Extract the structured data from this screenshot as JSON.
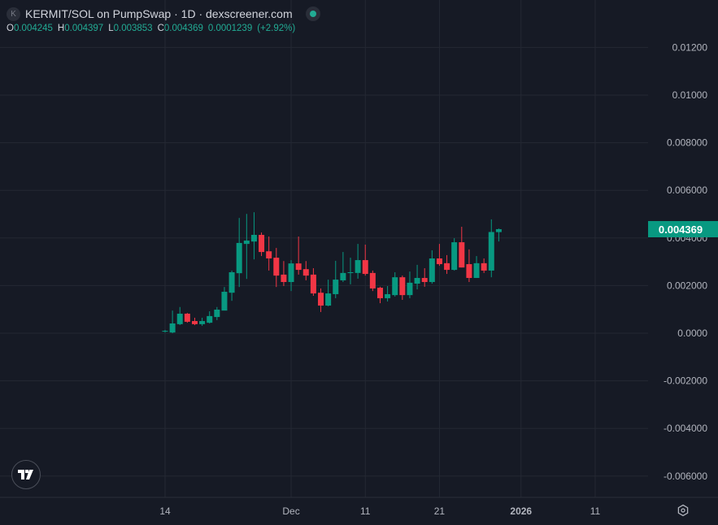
{
  "header": {
    "symbol_logo_letter": "K",
    "title": "KERMIT/SOL on PumpSwap · 1D · dexscreener.com",
    "ohlc": {
      "o_label": "O",
      "o": "0.004245",
      "h_label": "H",
      "h": "0.004397",
      "l_label": "L",
      "l": "0.003853",
      "c_label": "C",
      "c": "0.004369",
      "change": "0.0001239",
      "change_pct": "(+2.92%)"
    }
  },
  "colors": {
    "up": "#089981",
    "down": "#f23645",
    "background": "#161a25",
    "grid": "#242833",
    "last_price": "#089981"
  },
  "chart_data": {
    "type": "candlestick",
    "title": "KERMIT/SOL on PumpSwap · 1D",
    "interval": "1D",
    "first_candle_date": "Nov 14",
    "x_unit": "days since first candle",
    "ylim": [
      -0.0069,
      0.014
    ],
    "grid": true,
    "y_ticks": [
      {
        "value": 0.012,
        "label": "0.01200"
      },
      {
        "value": 0.01,
        "label": "0.01000"
      },
      {
        "value": 0.008,
        "label": "0.008000"
      },
      {
        "value": 0.006,
        "label": "0.006000"
      },
      {
        "value": 0.004,
        "label": "0.004000"
      },
      {
        "value": 0.002,
        "label": "0.002000"
      },
      {
        "value": 0.0,
        "label": "0.0000"
      },
      {
        "value": -0.002,
        "label": "-0.002000"
      },
      {
        "value": -0.004,
        "label": "-0.004000"
      },
      {
        "value": -0.006,
        "label": "-0.006000"
      }
    ],
    "x_ticks": [
      {
        "day": 0,
        "label": "14",
        "bold": false
      },
      {
        "day": 17,
        "label": "Dec",
        "bold": false
      },
      {
        "day": 27,
        "label": "11",
        "bold": false
      },
      {
        "day": 37,
        "label": "21",
        "bold": false
      },
      {
        "day": 48,
        "label": "2026",
        "bold": true
      },
      {
        "day": 58,
        "label": "11",
        "bold": false
      }
    ],
    "last_price": {
      "value": 0.004369,
      "label": "0.004369"
    },
    "candles_ohlc": [
      [
        7e-05,
        0.00014,
        3e-05,
        0.0001
      ],
      [
        3e-05,
        0.00095,
        0.0,
        0.00041
      ],
      [
        0.00038,
        0.0011,
        0.00034,
        0.00082
      ],
      [
        0.00082,
        0.00085,
        0.00044,
        0.00048
      ],
      [
        0.00051,
        0.00065,
        0.00034,
        0.00038
      ],
      [
        0.00038,
        0.00065,
        0.00031,
        0.00051
      ],
      [
        0.00044,
        0.00092,
        0.00041,
        0.00072
      ],
      [
        0.00068,
        0.0011,
        0.00055,
        0.00099
      ],
      [
        0.00095,
        0.00194,
        0.00133,
        0.00174
      ],
      [
        0.0017,
        0.00263,
        0.00136,
        0.00256
      ],
      [
        0.00252,
        0.00484,
        0.00194,
        0.00379
      ],
      [
        0.00375,
        0.00501,
        0.00228,
        0.00389
      ],
      [
        0.00385,
        0.00508,
        0.0031,
        0.00413
      ],
      [
        0.00413,
        0.00423,
        0.00324,
        0.00341
      ],
      [
        0.00344,
        0.00406,
        0.00263,
        0.00314
      ],
      [
        0.00317,
        0.00358,
        0.00194,
        0.00242
      ],
      [
        0.00246,
        0.00303,
        0.00198,
        0.00215
      ],
      [
        0.00215,
        0.00307,
        0.00177,
        0.00293
      ],
      [
        0.00293,
        0.00406,
        0.00246,
        0.00266
      ],
      [
        0.00269,
        0.00303,
        0.00222,
        0.00242
      ],
      [
        0.00246,
        0.00273,
        0.00157,
        0.00167
      ],
      [
        0.0017,
        0.00188,
        0.00089,
        0.00116
      ],
      [
        0.00116,
        0.00225,
        0.00113,
        0.00167
      ],
      [
        0.00164,
        0.00304,
        0.00147,
        0.00225
      ],
      [
        0.00222,
        0.00341,
        0.00215,
        0.00253
      ],
      [
        0.00254,
        0.00317,
        0.00205,
        0.00256
      ],
      [
        0.00253,
        0.00375,
        0.00229,
        0.00307
      ],
      [
        0.00307,
        0.00372,
        0.00242,
        0.00249
      ],
      [
        0.00253,
        0.00263,
        0.00177,
        0.00188
      ],
      [
        0.00191,
        0.00195,
        0.00126,
        0.00147
      ],
      [
        0.00147,
        0.00198,
        0.00133,
        0.00164
      ],
      [
        0.0016,
        0.00256,
        0.00154,
        0.00235
      ],
      [
        0.00235,
        0.00242,
        0.0014,
        0.0016
      ],
      [
        0.0016,
        0.00259,
        0.00147,
        0.00212
      ],
      [
        0.00208,
        0.00287,
        0.00184,
        0.00232
      ],
      [
        0.00232,
        0.00273,
        0.00195,
        0.00215
      ],
      [
        0.00215,
        0.00348,
        0.00208,
        0.00314
      ],
      [
        0.00314,
        0.00375,
        0.00283,
        0.0029
      ],
      [
        0.00294,
        0.00328,
        0.00249,
        0.00266
      ],
      [
        0.00266,
        0.00399,
        0.00263,
        0.00382
      ],
      [
        0.00382,
        0.00447,
        0.00276,
        0.00276
      ],
      [
        0.0029,
        0.00352,
        0.00215,
        0.00232
      ],
      [
        0.00232,
        0.00324,
        0.00232,
        0.00294
      ],
      [
        0.00294,
        0.00314,
        0.00253,
        0.00263
      ],
      [
        0.00263,
        0.00478,
        0.00235,
        0.00425
      ],
      [
        0.004245,
        0.004397,
        0.003853,
        0.004369
      ]
    ]
  }
}
